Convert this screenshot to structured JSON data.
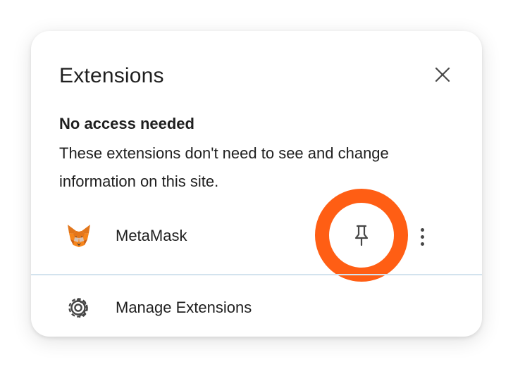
{
  "panel": {
    "title": "Extensions",
    "close_icon": "close-icon"
  },
  "section": {
    "heading": "No access needed",
    "description": "These extensions don't need to see and change information on this site."
  },
  "extensions": [
    {
      "name": "MetaMask",
      "icon": "metamask-fox-icon",
      "pin_icon": "pin-icon",
      "more_icon": "more-vertical-icon"
    }
  ],
  "manage": {
    "label": "Manage Extensions",
    "icon": "gear-icon"
  },
  "colors": {
    "highlight": "#ff5e14",
    "divider": "#d3e3ee",
    "text": "#1f1f1f"
  }
}
